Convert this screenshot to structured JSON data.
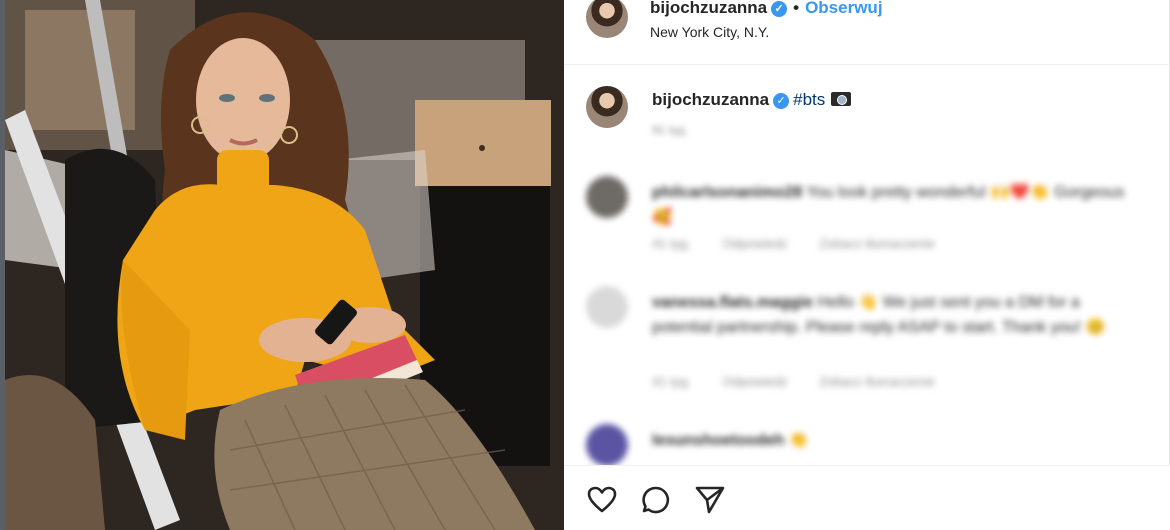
{
  "post": {
    "author": "bijochzuzanna",
    "follow_label": "Obserwuj",
    "separator": "•",
    "location": "New York City, N.Y.",
    "verified_icon": "verified-badge-icon"
  },
  "caption": {
    "author": "bijochzuzanna",
    "text": "#bts",
    "emoji": "camera-icon",
    "time": "91 tyg."
  },
  "comments": [
    {
      "user": "philcarlsonanimo28",
      "text": "You look pretty wonderful 🙌❤️👏 Gorgeous 🥰",
      "time": "41 tyg.",
      "reply": "Odpowiedz",
      "translate": "Zobacz tłumaczenie",
      "avatar_color": "#6e6a66"
    },
    {
      "user": "vanessa.flats.maggie",
      "text": "Hello 👋 We just sent you a DM for a potential partnership. Please reply ASAP to start. Thank you! 😊",
      "time": "41 tyg.",
      "reply": "Odpowiedz",
      "translate": "Zobacz tłumaczenie",
      "avatar_color": "#d9d9d9"
    },
    {
      "user": "lesunshoetoodeh",
      "text": "👏",
      "avatar_color": "#5b54a3"
    }
  ],
  "footer": {
    "icons": [
      "heart-icon",
      "comment-icon",
      "share-icon"
    ]
  },
  "colors": {
    "accent": "#3897f0",
    "hashtag": "#00376b",
    "sweater": "#f0a516"
  }
}
